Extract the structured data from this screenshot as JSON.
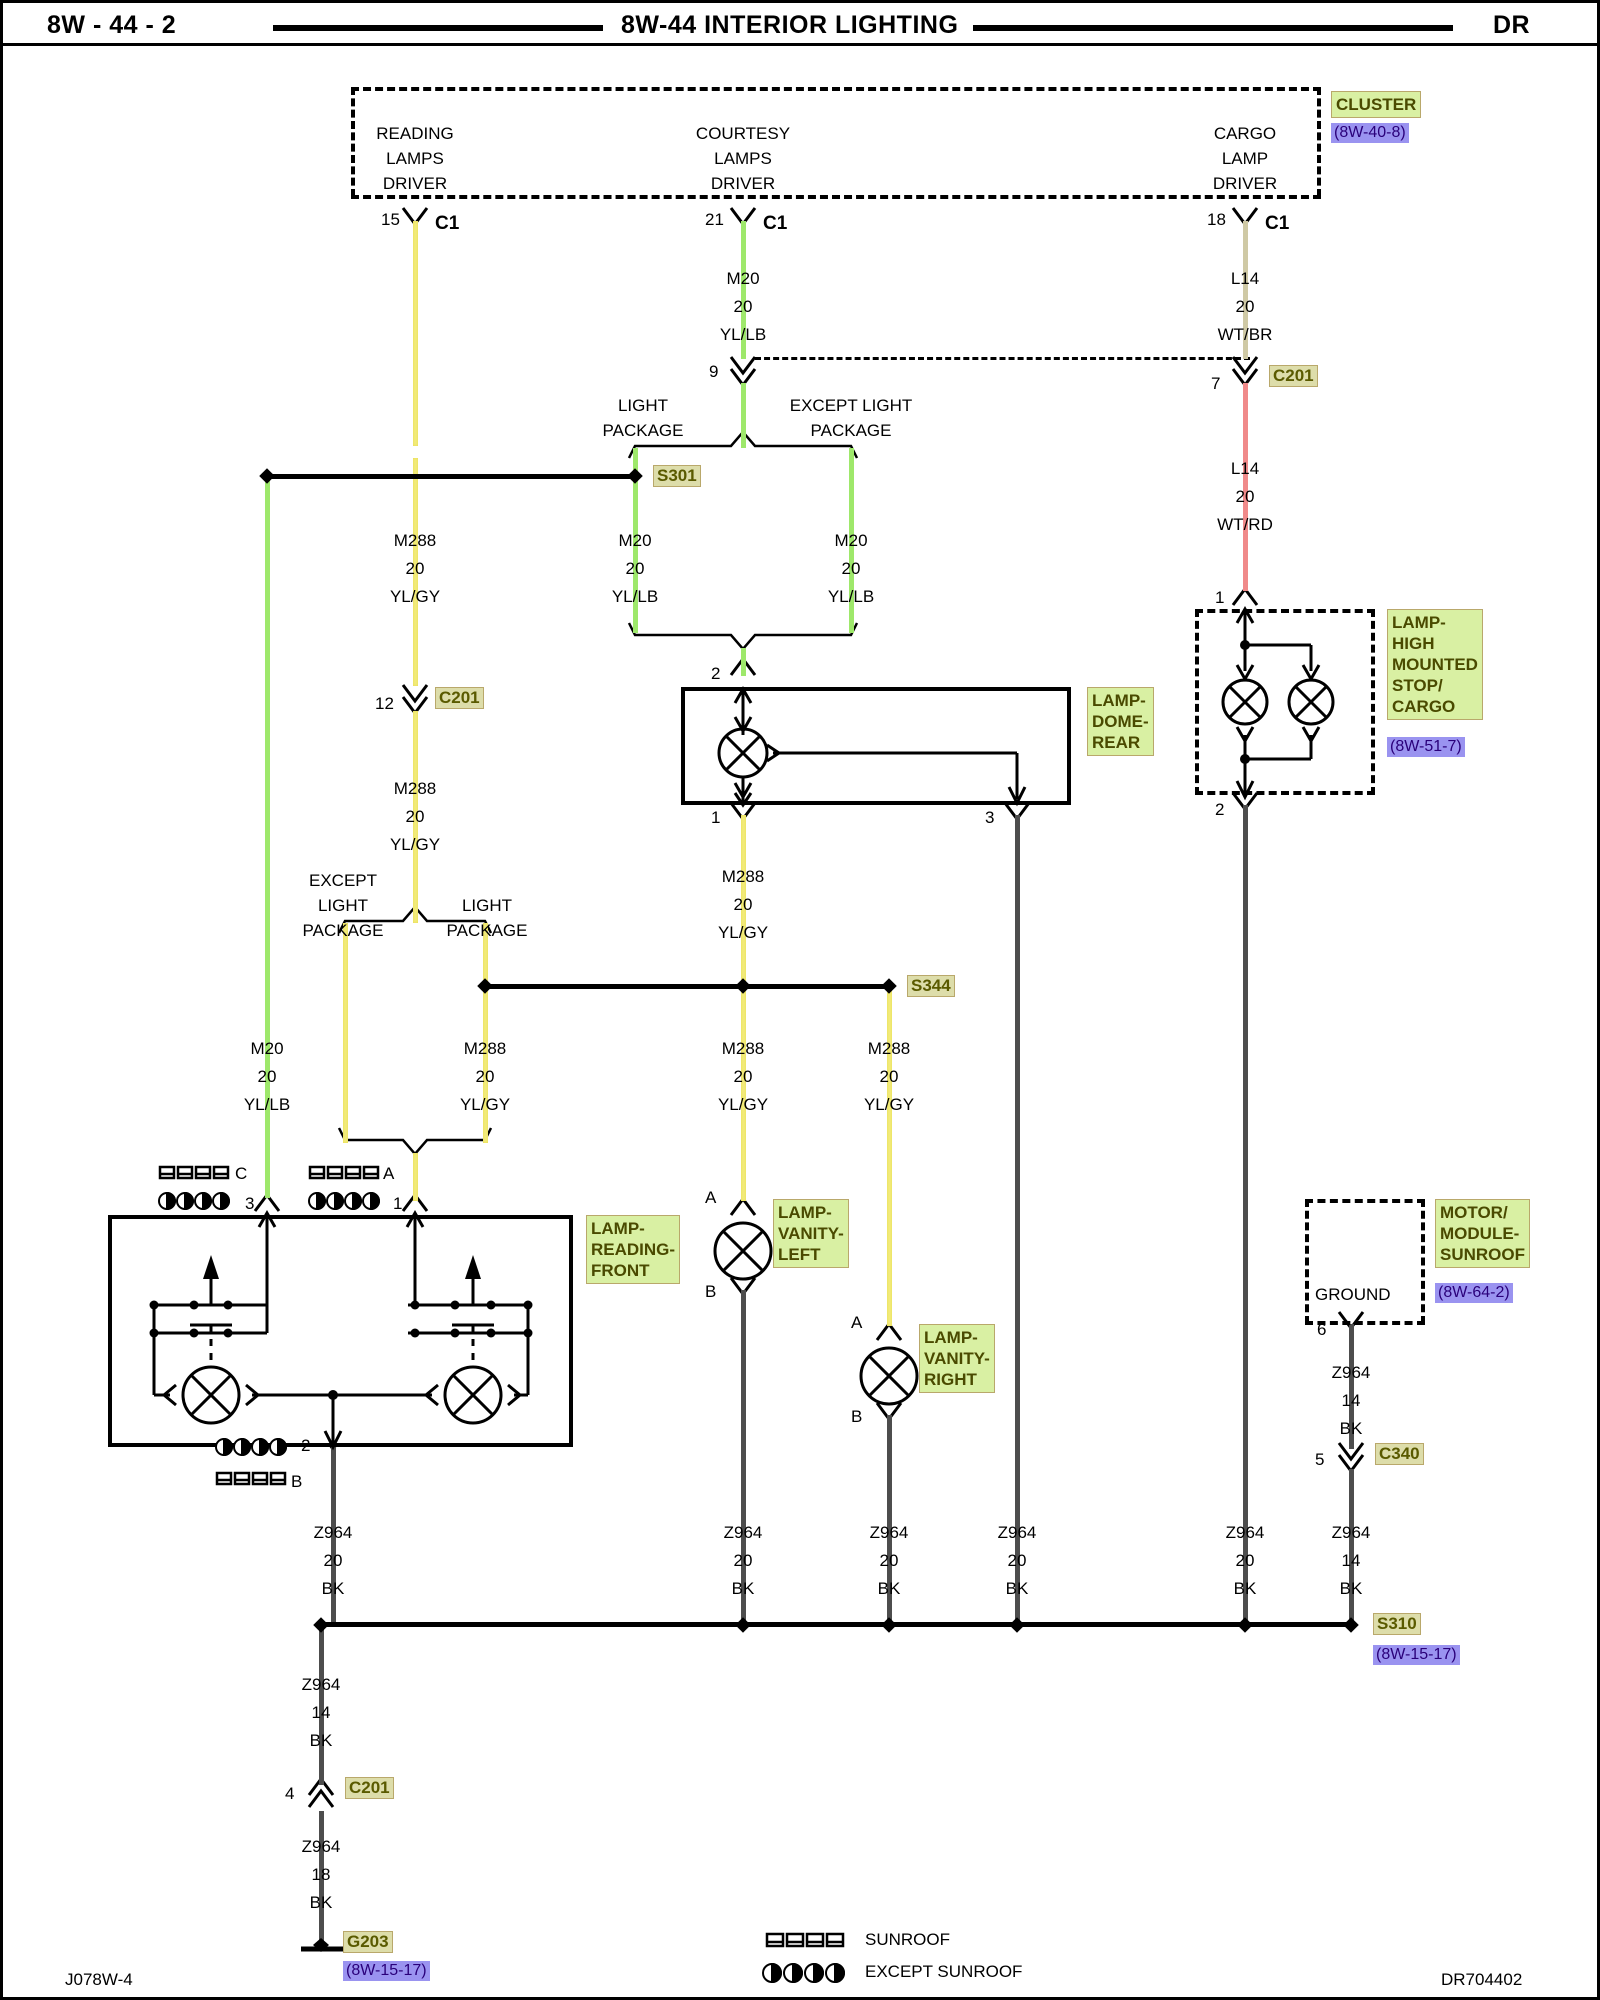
{
  "header": {
    "left": "8W - 44 - 2",
    "title": "8W-44 INTERIOR LIGHTING",
    "right": "DR"
  },
  "footer": {
    "left": "J078W-4",
    "right": "DR704402"
  },
  "cluster": {
    "name": "CLUSTER",
    "ref": "(8W-40-8)",
    "drivers": [
      {
        "label": "READING\nLAMPS\nDRIVER",
        "pin": "15",
        "connector": "C1"
      },
      {
        "label": "COURTESY\nLAMPS\nDRIVER",
        "pin": "21",
        "connector": "C1"
      },
      {
        "label": "CARGO\nLAMP\nDRIVER",
        "pin": "18",
        "connector": "C1"
      }
    ]
  },
  "components": [
    {
      "id": "lamp-dome-rear",
      "name": "LAMP-\nDOME-\nREAR",
      "ref": ""
    },
    {
      "id": "lamp-hmsl",
      "name": "LAMP-\nHIGH\nMOUNTED\nSTOP/\nCARGO",
      "ref": "(8W-51-7)"
    },
    {
      "id": "lamp-reading-front",
      "name": "LAMP-\nREADING-\nFRONT",
      "ref": ""
    },
    {
      "id": "lamp-vanity-left",
      "name": "LAMP-\nVANITY-\nLEFT",
      "ref": ""
    },
    {
      "id": "lamp-vanity-right",
      "name": "LAMP-\nVANITY-\nRIGHT",
      "ref": ""
    },
    {
      "id": "motor-module-sunroof",
      "name": "MOTOR/\nMODULE-\nSUNROOF",
      "ref": "(8W-64-2)",
      "inner_label": "GROUND"
    }
  ],
  "option_brackets": [
    {
      "id": "opt-s301-top",
      "left": "LIGHT\nPACKAGE",
      "right": "EXCEPT LIGHT\nPACKAGE"
    },
    {
      "id": "opt-reading",
      "left": "EXCEPT\nLIGHT\nPACKAGE",
      "right": "LIGHT\nPACKAGE"
    }
  ],
  "wires": [
    {
      "id": "w-m20-courtesy-top",
      "circuit": "M20",
      "gauge": "20",
      "color": "YL/LB"
    },
    {
      "id": "w-l14-wtbr",
      "circuit": "L14",
      "gauge": "20",
      "color": "WT/BR"
    },
    {
      "id": "w-l14-wtrd",
      "circuit": "L14",
      "gauge": "20",
      "color": "WT/RD"
    },
    {
      "id": "w-m288-reading-upper",
      "circuit": "M288",
      "gauge": "20",
      "color": "YL/GY"
    },
    {
      "id": "w-m20-light-pkg",
      "circuit": "M20",
      "gauge": "20",
      "color": "YL/LB"
    },
    {
      "id": "w-m20-except-pkg",
      "circuit": "M20",
      "gauge": "20",
      "color": "YL/LB"
    },
    {
      "id": "w-m288-reading-lower",
      "circuit": "M288",
      "gauge": "20",
      "color": "YL/GY"
    },
    {
      "id": "w-m20-left",
      "circuit": "M20",
      "gauge": "20",
      "color": "YL/LB"
    },
    {
      "id": "w-m288-readingA",
      "circuit": "M288",
      "gauge": "20",
      "color": "YL/GY"
    },
    {
      "id": "w-m288-dome1",
      "circuit": "M288",
      "gauge": "20",
      "color": "YL/GY"
    },
    {
      "id": "w-m288-vanL",
      "circuit": "M288",
      "gauge": "20",
      "color": "YL/GY"
    },
    {
      "id": "w-m288-vanR",
      "circuit": "M288",
      "gauge": "20",
      "color": "YL/GY"
    },
    {
      "id": "w-z964-reading",
      "circuit": "Z964",
      "gauge": "20",
      "color": "BK"
    },
    {
      "id": "w-z964-vanL",
      "circuit": "Z964",
      "gauge": "20",
      "color": "BK"
    },
    {
      "id": "w-z964-vanR",
      "circuit": "Z964",
      "gauge": "20",
      "color": "BK"
    },
    {
      "id": "w-z964-dome3",
      "circuit": "Z964",
      "gauge": "20",
      "color": "BK"
    },
    {
      "id": "w-z964-hmsl",
      "circuit": "Z964",
      "gauge": "20",
      "color": "BK"
    },
    {
      "id": "w-z964-sunroof-upper",
      "circuit": "Z964",
      "gauge": "14",
      "color": "BK"
    },
    {
      "id": "w-z964-sunroof-lower",
      "circuit": "Z964",
      "gauge": "14",
      "color": "BK"
    },
    {
      "id": "w-z964-g203-upper",
      "circuit": "Z964",
      "gauge": "14",
      "color": "BK"
    },
    {
      "id": "w-z964-g203-lower",
      "circuit": "Z964",
      "gauge": "18",
      "color": "BK"
    }
  ],
  "connectors": [
    {
      "id": "c201-courtesy",
      "name": "C201",
      "pin": "7"
    },
    {
      "id": "c201-reading",
      "name": "C201",
      "pin": "12"
    },
    {
      "id": "c340-sunroof",
      "name": "C340",
      "pin": "5"
    },
    {
      "id": "c201-ground",
      "name": "C201",
      "pin": "4"
    }
  ],
  "splices": [
    {
      "id": "s301",
      "name": "S301",
      "ref": ""
    },
    {
      "id": "s344",
      "name": "S344",
      "ref": ""
    },
    {
      "id": "s310",
      "name": "S310",
      "ref": "(8W-15-17)"
    }
  ],
  "grounds": [
    {
      "id": "g203",
      "name": "G203",
      "ref": "(8W-15-17)"
    }
  ],
  "pins": {
    "courtesy_split": "9",
    "dome_top": "2",
    "dome_left": "1",
    "dome_right": "3",
    "hmsl_top": "1",
    "hmsl_bottom": "2",
    "reading_pin3": "3",
    "reading_pin3_letter": "C",
    "reading_pin1": "1",
    "reading_pin1_letter": "A",
    "reading_pin2": "2",
    "reading_pin2_letter": "B",
    "vanity_a": "A",
    "vanity_b": "B",
    "sunroof_gnd": "6"
  },
  "legend": [
    {
      "symbol": "sunroof-bar-icon",
      "label": "SUNROOF"
    },
    {
      "symbol": "except-sunroof-circle-icon",
      "label": "EXCEPT SUNROOF"
    }
  ]
}
